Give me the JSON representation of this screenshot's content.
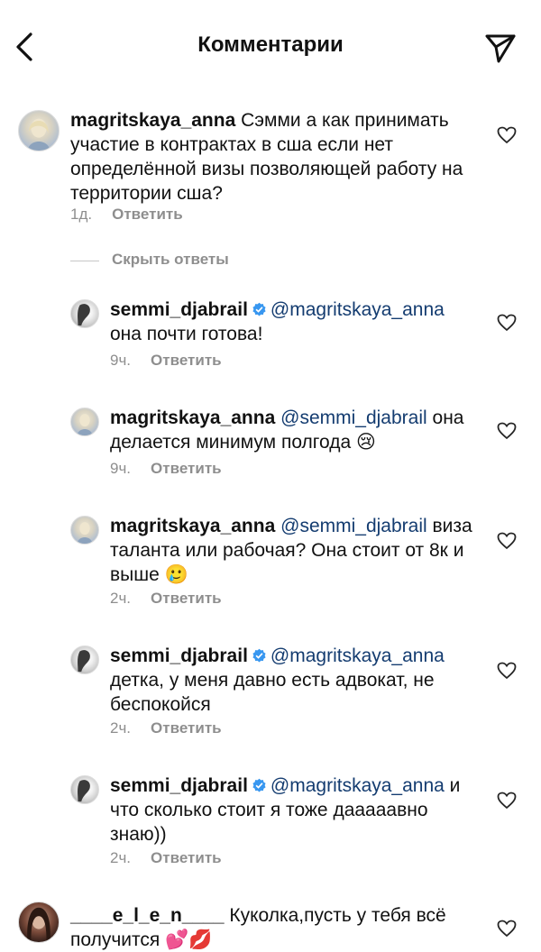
{
  "header": {
    "title": "Комментарии",
    "back_icon": "chevron-left-icon",
    "send_icon": "paper-plane-icon"
  },
  "colors": {
    "mention": "#143c70",
    "meta": "#8e8e8e",
    "text": "#111111"
  },
  "hide_replies_label": "Скрыть ответы",
  "reply_label": "Ответить",
  "comments": [
    {
      "username": "magritskaya_anna",
      "text": "Сэмми а как принимать участие в контрактах в сша если нет определённой визы позволяющей работу на территории сша?",
      "time": "1д."
    },
    {
      "username": "semmi_djabrail",
      "verified": true,
      "mention": "@magritskaya_anna",
      "text": "она почти готова!",
      "time": "9ч."
    },
    {
      "username": "magritskaya_anna",
      "mention": "@semmi_djabrail",
      "text": "она делается минимум полгода 😢",
      "time": "9ч."
    },
    {
      "username": "magritskaya_anna",
      "mention": "@semmi_djabrail",
      "text": "виза таланта или рабочая? Она стоит от 8к и выше 🥲",
      "time": "2ч."
    },
    {
      "username": "semmi_djabrail",
      "verified": true,
      "mention": "@magritskaya_anna",
      "text": "детка, у меня давно есть адвокат, не беспокойся",
      "time": "2ч."
    },
    {
      "username": "semmi_djabrail",
      "verified": true,
      "mention": "@magritskaya_anna",
      "text": "и что сколько стоит я тоже дааааавно знаю))",
      "time": "2ч."
    },
    {
      "username": "____e_l_e_n____",
      "text": "Куколка,пусть у тебя всё получится 💕💋"
    }
  ]
}
